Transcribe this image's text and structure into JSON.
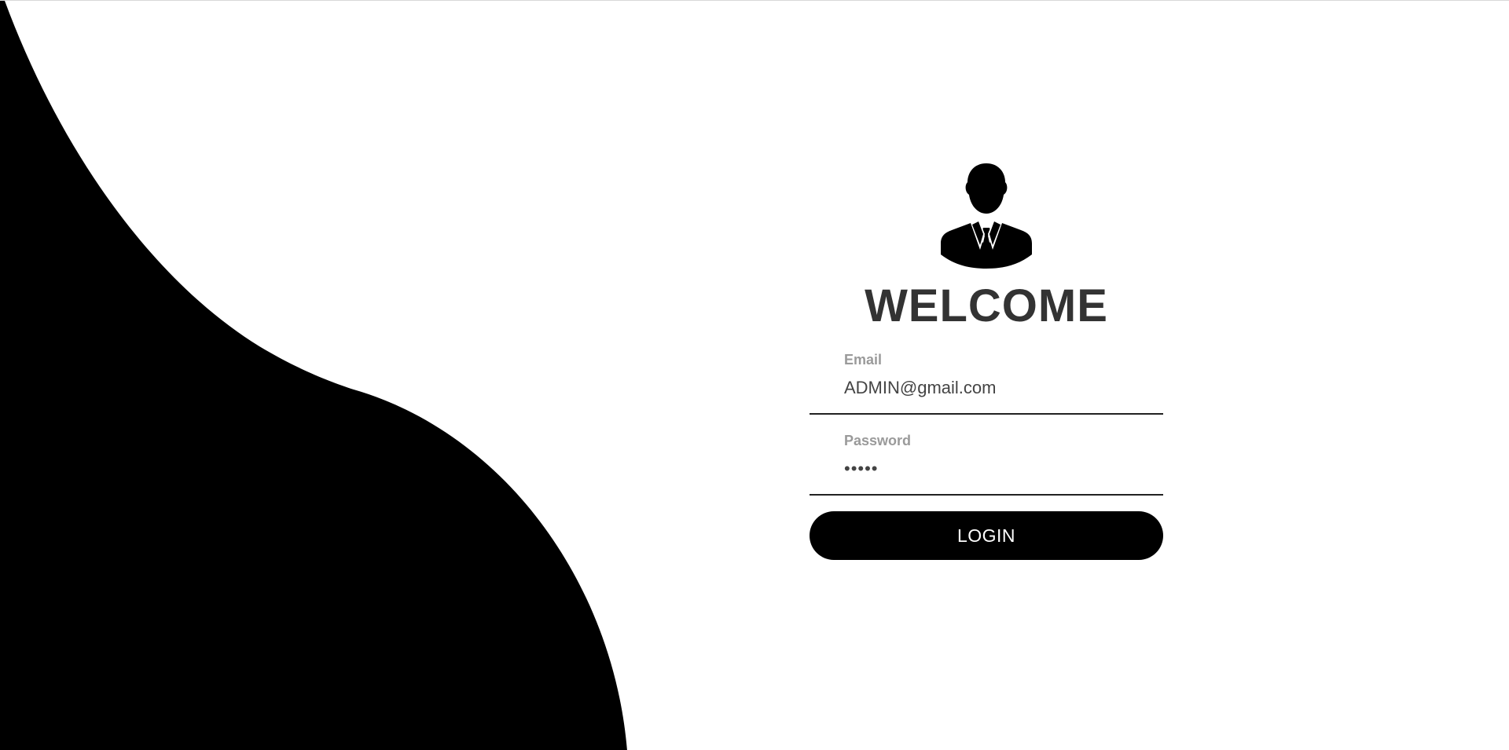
{
  "login": {
    "heading": "WELCOME",
    "email_label": "Email",
    "email_value": "ADMIN@gmail.com",
    "password_label": "Password",
    "password_value": "•••••",
    "button_label": "LOGIN"
  },
  "icons": {
    "avatar": "user-avatar-icon"
  },
  "colors": {
    "background": "#ffffff",
    "wave": "#000000",
    "heading": "#333333",
    "label": "#9a9a9a",
    "button": "#000000",
    "button_text": "#ffffff"
  }
}
